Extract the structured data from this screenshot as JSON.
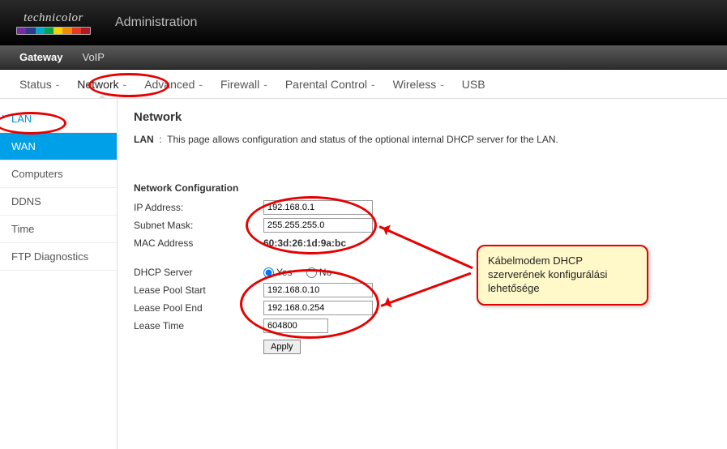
{
  "header": {
    "brand": "technicolor",
    "title": "Administration"
  },
  "topnav": {
    "items": [
      "Gateway",
      "VoIP"
    ],
    "active": 0
  },
  "subnav": {
    "items": [
      "Status",
      "Network",
      "Advanced",
      "Firewall",
      "Parental Control",
      "Wireless",
      "USB"
    ],
    "active": 1
  },
  "sidebar": {
    "items": [
      "LAN",
      "WAN",
      "Computers",
      "DDNS",
      "Time",
      "FTP Diagnostics"
    ],
    "current": 0,
    "active": 1
  },
  "page": {
    "heading": "Network",
    "desc_label": "LAN",
    "desc_text": "This page allows configuration and status of the optional internal DHCP server for the LAN.",
    "section1": "Network Configuration",
    "labels": {
      "ip": "IP Address:",
      "subnet": "Subnet Mask:",
      "mac": "MAC Address",
      "dhcp": "DHCP Server",
      "yes": "Yes",
      "no": "No",
      "lps": "Lease Pool Start",
      "lpe": "Lease Pool End",
      "lt": "Lease Time",
      "apply": "Apply"
    },
    "values": {
      "ip": "192.168.0.1",
      "subnet": "255.255.255.0",
      "mac": "60:3d:26:1d:9a:bc",
      "dhcp_yes": true,
      "lps": "192.168.0.10",
      "lpe": "192.168.0.254",
      "lt": "604800"
    }
  },
  "annotation": {
    "callout": "Kábelmodem DHCP szerverének konfigurálási lehetősége"
  },
  "logo_colors": [
    "#7b2aa6",
    "#2e3a8c",
    "#00a9c7",
    "#00a44a",
    "#f6d400",
    "#f08c00",
    "#e53924",
    "#b0182a"
  ]
}
